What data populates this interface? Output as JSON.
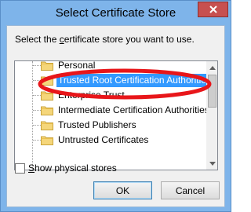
{
  "window": {
    "title": "Select Certificate Store",
    "close_icon": "close-icon"
  },
  "dialog": {
    "prompt_prefix": "Select the ",
    "prompt_accel": "c",
    "prompt_suffix": "ertificate store you want to use."
  },
  "tree": {
    "items": [
      {
        "label": "Personal",
        "selected": false
      },
      {
        "label": "Trusted Root Certification Authorities",
        "selected": true
      },
      {
        "label": "Enterprise Trust",
        "selected": false
      },
      {
        "label": "Intermediate Certification Authorities",
        "selected": false
      },
      {
        "label": "Trusted Publishers",
        "selected": false
      },
      {
        "label": "Untrusted Certificates",
        "selected": false
      }
    ]
  },
  "annotation": {
    "color": "#e8161a"
  },
  "options": {
    "show_physical_accel": "S",
    "show_physical_rest": "how physical stores",
    "checked": false
  },
  "buttons": {
    "ok": "OK",
    "cancel": "Cancel"
  }
}
